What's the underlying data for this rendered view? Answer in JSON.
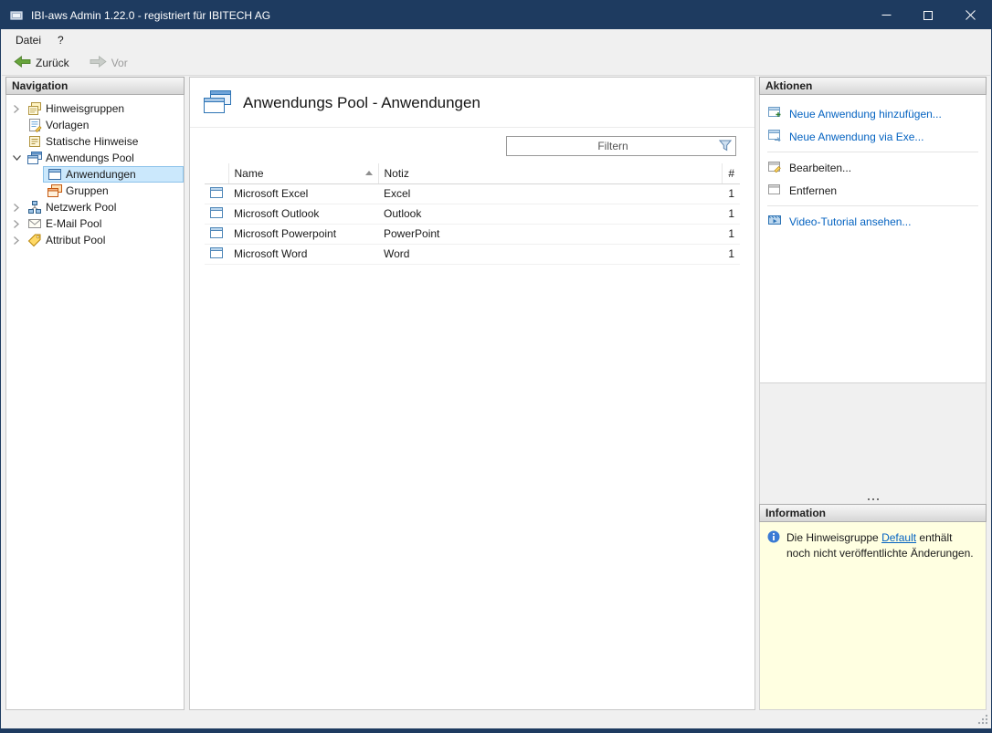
{
  "window": {
    "title": "IBI-aws Admin 1.22.0 - registriert für IBITECH AG",
    "controls": [
      "minimize",
      "maximize",
      "close"
    ]
  },
  "menubar": {
    "items": [
      {
        "label": "Datei"
      },
      {
        "label": "?"
      }
    ]
  },
  "toolbar": {
    "back_label": "Zurück",
    "forward_label": "Vor",
    "back_icon": "back-arrow-icon",
    "forward_icon": "forward-arrow-icon",
    "forward_disabled": true
  },
  "nav": {
    "header": "Navigation",
    "items": [
      {
        "label": "Hinweisgruppen",
        "icon": "hinweisgruppen-icon",
        "state": "collapsed",
        "level": 0
      },
      {
        "label": "Vorlagen",
        "icon": "vorlagen-icon",
        "state": "leaf",
        "level": 0
      },
      {
        "label": "Statische Hinweise",
        "icon": "statische-hinweise-icon",
        "state": "leaf",
        "level": 0
      },
      {
        "label": "Anwendungs Pool",
        "icon": "anwendungs-pool-icon",
        "state": "expanded",
        "level": 0
      },
      {
        "label": "Anwendungen",
        "icon": "anwendungen-icon",
        "state": "leaf",
        "level": 1,
        "selected": true
      },
      {
        "label": "Gruppen",
        "icon": "gruppen-icon",
        "state": "leaf",
        "level": 1
      },
      {
        "label": "Netzwerk Pool",
        "icon": "netzwerk-pool-icon",
        "state": "collapsed",
        "level": 0
      },
      {
        "label": "E-Mail Pool",
        "icon": "email-pool-icon",
        "state": "collapsed",
        "level": 0
      },
      {
        "label": "Attribut Pool",
        "icon": "attribut-pool-icon",
        "state": "collapsed",
        "level": 0
      }
    ]
  },
  "main": {
    "title": "Anwendungs Pool - Anwendungen",
    "title_icon": "applications-stack-icon",
    "filter": {
      "placeholder": "Filtern",
      "icon": "filter-funnel-icon"
    },
    "table": {
      "columns": [
        {
          "label": "Name",
          "sorted": "asc"
        },
        {
          "label": "Notiz"
        },
        {
          "label": "#"
        }
      ],
      "row_icon": "application-window-icon",
      "rows": [
        {
          "name": "Microsoft Excel",
          "notiz": "Excel",
          "count": "1"
        },
        {
          "name": "Microsoft Outlook",
          "notiz": "Outlook",
          "count": "1"
        },
        {
          "name": "Microsoft Powerpoint",
          "notiz": "PowerPoint",
          "count": "1"
        },
        {
          "name": "Microsoft Word",
          "notiz": "Word",
          "count": "1"
        }
      ]
    }
  },
  "actions": {
    "header": "Aktionen",
    "items": [
      {
        "label": "Neue Anwendung hinzufügen...",
        "style": "link",
        "icon": "new-application-icon"
      },
      {
        "label": "Neue Anwendung via Exe...",
        "style": "link",
        "icon": "new-application-exe-icon"
      },
      {
        "label": "Bearbeiten...",
        "style": "normal",
        "icon": "edit-icon"
      },
      {
        "label": "Entfernen",
        "style": "normal",
        "icon": "remove-icon"
      },
      {
        "label": "Video-Tutorial ansehen...",
        "style": "link",
        "icon": "video-tutorial-icon"
      }
    ]
  },
  "information": {
    "header": "Information",
    "icon": "info-icon",
    "text_prefix": "Die Hinweisgruppe ",
    "link_label": "Default",
    "text_suffix": " enthält noch nicht veröffentlichte Änderungen."
  },
  "colors": {
    "titlebar": "#1e3b60",
    "link_blue": "#0563c1",
    "tree_selection": "#cbe8fc",
    "info_background": "#ffffe1",
    "panel_header_gradient_bottom": "#d6d6d6"
  }
}
